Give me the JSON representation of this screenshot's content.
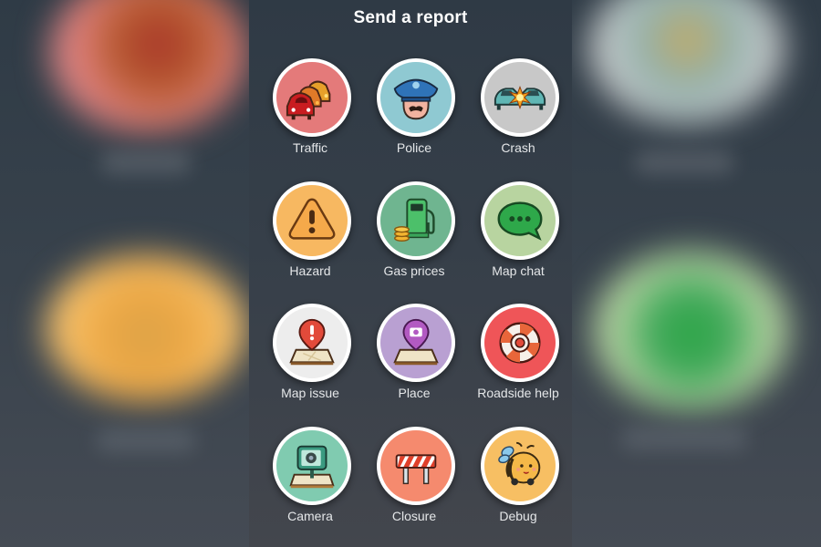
{
  "header": {
    "title": "Send a report"
  },
  "reports": [
    {
      "id": "traffic",
      "label": "Traffic",
      "icon": "traffic-cars-icon",
      "color": "#e47a7a"
    },
    {
      "id": "police",
      "label": "Police",
      "icon": "police-officer-icon",
      "color": "#8fc9d2"
    },
    {
      "id": "crash",
      "label": "Crash",
      "icon": "car-crash-icon",
      "color": "#c8c8c8"
    },
    {
      "id": "hazard",
      "label": "Hazard",
      "icon": "hazard-warning-icon",
      "color": "#f7b861"
    },
    {
      "id": "gas-prices",
      "label": "Gas prices",
      "icon": "gas-pump-icon",
      "color": "#6fb590"
    },
    {
      "id": "map-chat",
      "label": "Map chat",
      "icon": "chat-bubble-icon",
      "color": "#b8d4a0"
    },
    {
      "id": "map-issue",
      "label": "Map issue",
      "icon": "map-issue-pin-icon",
      "color": "#ededed"
    },
    {
      "id": "place",
      "label": "Place",
      "icon": "place-camera-pin-icon",
      "color": "#b9a0d2"
    },
    {
      "id": "roadside-help",
      "label": "Roadside help",
      "icon": "lifebuoy-icon",
      "color": "#ef5558"
    },
    {
      "id": "camera",
      "label": "Camera",
      "icon": "speed-camera-icon",
      "color": "#80cbb0"
    },
    {
      "id": "closure",
      "label": "Closure",
      "icon": "road-barrier-icon",
      "color": "#f58a6e"
    },
    {
      "id": "debug",
      "label": "Debug",
      "icon": "bee-bug-icon",
      "color": "#f7bf63"
    }
  ]
}
